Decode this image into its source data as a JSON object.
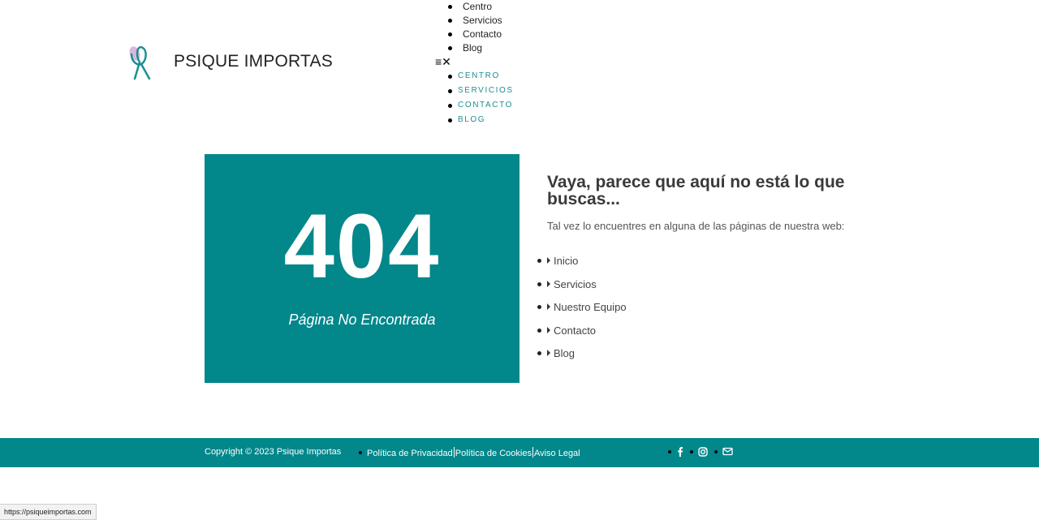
{
  "brand": {
    "name": "PSIQUE IMPORTAS"
  },
  "nav_top": [
    "Centro",
    "Servicios",
    "Contacto",
    "Blog"
  ],
  "menu_toggle": {
    "icons": [
      "hamburger-icon",
      "close-icon"
    ]
  },
  "nav_mobile": [
    "CENTRO",
    "SERVICIOS",
    "CONTACTO",
    "BLOG"
  ],
  "error": {
    "code": "404",
    "subtitle": "Página No Encontrada"
  },
  "content": {
    "headline": "Vaya, parece que aquí no está lo que buscas...",
    "hint": "Tal vez lo encuentres en alguna de las páginas de nuestra web:",
    "links": [
      "Inicio",
      "Servicios",
      "Nuestro Equipo",
      "Contacto",
      "Blog"
    ]
  },
  "footer": {
    "copyright": "Copyright © 2023 Psique Importas",
    "legal": [
      "Política de Privacidad",
      "Política de Cookies",
      "Aviso Legal"
    ],
    "social": [
      "facebook-icon",
      "instagram-icon",
      "mail-icon"
    ]
  },
  "status_bar": {
    "url": "https://psiqueimportas.com"
  },
  "colors": {
    "brand_teal": "#02878b",
    "nav_link": "#1d8e93"
  }
}
